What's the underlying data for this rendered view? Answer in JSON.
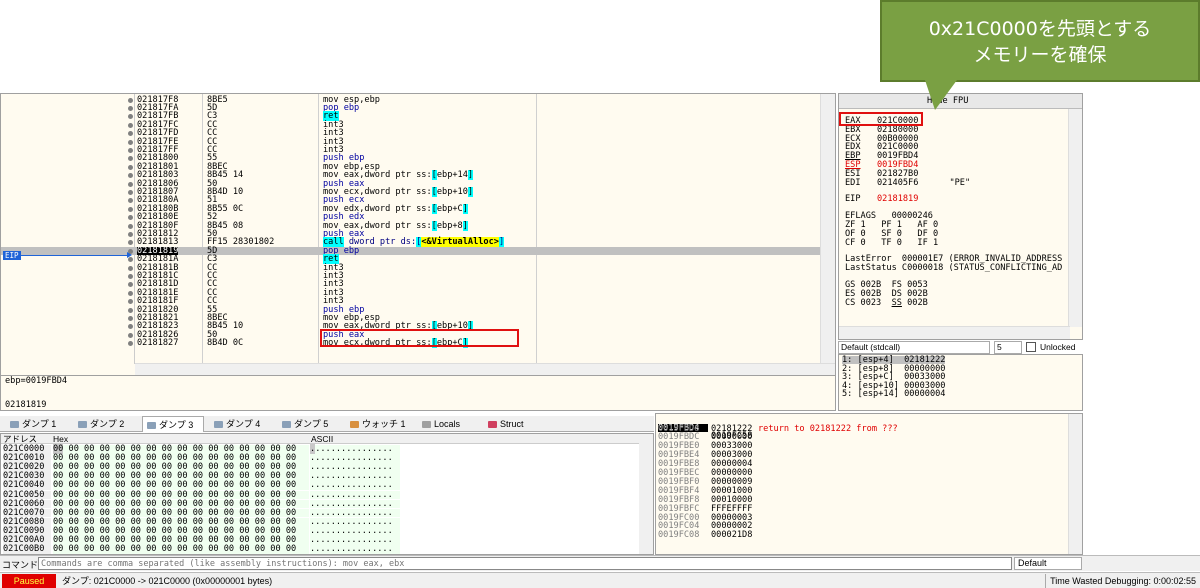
{
  "callout": {
    "line1": "0x21C0000を先頭とする",
    "line2": "メモリーを確保"
  },
  "disasm": {
    "eip_label": "EIP",
    "rows": [
      {
        "addr": "021817F8",
        "bytes": "8BE5",
        "instr": "mov esp,ebp"
      },
      {
        "addr": "021817FA",
        "bytes": "5D",
        "instr": "pop ebp"
      },
      {
        "addr": "021817FB",
        "bytes": "C3",
        "instr": "ret"
      },
      {
        "addr": "021817FC",
        "bytes": "CC",
        "instr": "int3"
      },
      {
        "addr": "021817FD",
        "bytes": "CC",
        "instr": "int3"
      },
      {
        "addr": "021817FE",
        "bytes": "CC",
        "instr": "int3"
      },
      {
        "addr": "021817FF",
        "bytes": "CC",
        "instr": "int3"
      },
      {
        "addr": "02181800",
        "bytes": "55",
        "instr": "push ebp"
      },
      {
        "addr": "02181801",
        "bytes": "8BEC",
        "instr": "mov ebp,esp"
      },
      {
        "addr": "02181803",
        "bytes": "8B45 14",
        "instr": "mov eax,dword ptr ss:[ebp+14]"
      },
      {
        "addr": "02181806",
        "bytes": "50",
        "instr": "push eax"
      },
      {
        "addr": "02181807",
        "bytes": "8B4D 10",
        "instr": "mov ecx,dword ptr ss:[ebp+10]"
      },
      {
        "addr": "0218180A",
        "bytes": "51",
        "instr": "push ecx"
      },
      {
        "addr": "0218180B",
        "bytes": "8B55 0C",
        "instr": "mov edx,dword ptr ss:[ebp+C]"
      },
      {
        "addr": "0218180E",
        "bytes": "52",
        "instr": "push edx"
      },
      {
        "addr": "0218180F",
        "bytes": "8B45 08",
        "instr": "mov eax,dword ptr ss:[ebp+8]"
      },
      {
        "addr": "02181812",
        "bytes": "50",
        "instr": "push eax"
      },
      {
        "addr": "02181813",
        "bytes": "FF15 28301802",
        "instr": "call dword ptr ds:[<&VirtualAlloc>]"
      },
      {
        "addr": "02181819",
        "bytes": "5D",
        "instr": "pop ebp"
      },
      {
        "addr": "0218181A",
        "bytes": "C3",
        "instr": "ret"
      },
      {
        "addr": "0218181B",
        "bytes": "CC",
        "instr": "int3"
      },
      {
        "addr": "0218181C",
        "bytes": "CC",
        "instr": "int3"
      },
      {
        "addr": "0218181D",
        "bytes": "CC",
        "instr": "int3"
      },
      {
        "addr": "0218181E",
        "bytes": "CC",
        "instr": "int3"
      },
      {
        "addr": "0218181F",
        "bytes": "CC",
        "instr": "int3"
      },
      {
        "addr": "02181820",
        "bytes": "55",
        "instr": "push ebp"
      },
      {
        "addr": "02181821",
        "bytes": "8BEC",
        "instr": "mov ebp,esp"
      },
      {
        "addr": "02181823",
        "bytes": "8B45 10",
        "instr": "mov eax,dword ptr ss:[ebp+10]"
      },
      {
        "addr": "02181826",
        "bytes": "50",
        "instr": "push eax"
      },
      {
        "addr": "02181827",
        "bytes": "8B4D 0C",
        "instr": "mov ecx,dword ptr ss:[ebp+C]"
      }
    ]
  },
  "info": {
    "line1": "ebp=0019FBD4",
    "line2": "02181819"
  },
  "registers": {
    "title": "Hide FPU",
    "gp": [
      {
        "name": "EAX",
        "val": "021C0000",
        "red": false
      },
      {
        "name": "EBX",
        "val": "02180000",
        "red": false
      },
      {
        "name": "ECX",
        "val": "00B00000",
        "red": false
      },
      {
        "name": "EDX",
        "val": "021C0000",
        "red": false
      },
      {
        "name": "EBP",
        "val": "0019FBD4",
        "red": false
      },
      {
        "name": "ESP",
        "val": "0019FBD4",
        "red": true
      },
      {
        "name": "ESI",
        "val": "021827B0",
        "red": false
      },
      {
        "name": "EDI",
        "val": "021405F6",
        "red": false,
        "comment": "\"PE\""
      }
    ],
    "eip": {
      "name": "EIP",
      "val": "02181819"
    },
    "eflags": {
      "name": "EFLAGS",
      "val": "00000246"
    },
    "flags_line1": "ZF 1   PF 1   AF 0",
    "flags_line2": "OF 0   SF 0   DF 0",
    "flags_line3": "CF 0   TF 0   IF 1",
    "lasterror": "LastError  000001E7 (ERROR_INVALID_ADDRESS",
    "laststatus": "LastStatus C0000018 (STATUS_CONFLICTING_AD",
    "seg1": "GS 002B  FS 0053",
    "seg2": "ES 002B  DS 002B",
    "seg3": "CS 0023  SS 002B"
  },
  "callconv": {
    "selected": "Default (stdcall)",
    "count": "5",
    "unlocked_label": "Unlocked"
  },
  "args": [
    "1: [esp+4]  02181222",
    "2: [esp+8]  00000000",
    "3: [esp+C]  00033000",
    "4: [esp+10] 00003000",
    "5: [esp+14] 00000004"
  ],
  "tabs": [
    {
      "label": "ダンプ 1",
      "icon": "dump-icon"
    },
    {
      "label": "ダンプ 2",
      "icon": "dump-icon"
    },
    {
      "label": "ダンプ 3",
      "icon": "dump-icon",
      "active": true
    },
    {
      "label": "ダンプ 4",
      "icon": "dump-icon"
    },
    {
      "label": "ダンプ 5",
      "icon": "dump-icon"
    },
    {
      "label": "ウォッチ 1",
      "icon": "watch-icon"
    },
    {
      "label": "Locals",
      "icon": "locals-icon"
    },
    {
      "label": "Struct",
      "icon": "struct-icon"
    }
  ],
  "dump": {
    "headers": {
      "addr": "アドレス",
      "hex": "Hex",
      "ascii": "ASCII"
    },
    "rows": [
      {
        "addr": "021C0000",
        "hex": "00 00 00 00 00 00 00 00 00 00 00 00 00 00 00 00",
        "ascii": "................"
      },
      {
        "addr": "021C0010",
        "hex": "00 00 00 00 00 00 00 00 00 00 00 00 00 00 00 00",
        "ascii": "................"
      },
      {
        "addr": "021C0020",
        "hex": "00 00 00 00 00 00 00 00 00 00 00 00 00 00 00 00",
        "ascii": "................"
      },
      {
        "addr": "021C0030",
        "hex": "00 00 00 00 00 00 00 00 00 00 00 00 00 00 00 00",
        "ascii": "................"
      },
      {
        "addr": "021C0040",
        "hex": "00 00 00 00 00 00 00 00 00 00 00 00 00 00 00 00",
        "ascii": "................"
      },
      {
        "addr": "021C0050",
        "hex": "00 00 00 00 00 00 00 00 00 00 00 00 00 00 00 00",
        "ascii": "................"
      },
      {
        "addr": "021C0060",
        "hex": "00 00 00 00 00 00 00 00 00 00 00 00 00 00 00 00",
        "ascii": "................"
      },
      {
        "addr": "021C0070",
        "hex": "00 00 00 00 00 00 00 00 00 00 00 00 00 00 00 00",
        "ascii": "................"
      },
      {
        "addr": "021C0080",
        "hex": "00 00 00 00 00 00 00 00 00 00 00 00 00 00 00 00",
        "ascii": "................"
      },
      {
        "addr": "021C0090",
        "hex": "00 00 00 00 00 00 00 00 00 00 00 00 00 00 00 00",
        "ascii": "................"
      },
      {
        "addr": "021C00A0",
        "hex": "00 00 00 00 00 00 00 00 00 00 00 00 00 00 00 00",
        "ascii": "................"
      },
      {
        "addr": "021C00B0",
        "hex": "00 00 00 00 00 00 00 00 00 00 00 00 00 00 00 00",
        "ascii": "................"
      }
    ]
  },
  "stack": {
    "header_addr": "0019FBD4",
    "header_val": "0019FC58",
    "rows": [
      {
        "addr": "0019FBD8",
        "val": "02181222",
        "comment": "return to 02181222 from ???"
      },
      {
        "addr": "0019FBDC",
        "val": "00000000",
        "comment": ""
      },
      {
        "addr": "0019FBE0",
        "val": "00033000",
        "comment": ""
      },
      {
        "addr": "0019FBE4",
        "val": "00003000",
        "comment": ""
      },
      {
        "addr": "0019FBE8",
        "val": "00000004",
        "comment": ""
      },
      {
        "addr": "0019FBEC",
        "val": "00000000",
        "comment": ""
      },
      {
        "addr": "0019FBF0",
        "val": "00000009",
        "comment": ""
      },
      {
        "addr": "0019FBF4",
        "val": "00001000",
        "comment": ""
      },
      {
        "addr": "0019FBF8",
        "val": "00010000",
        "comment": ""
      },
      {
        "addr": "0019FBFC",
        "val": "FFFEFFFF",
        "comment": ""
      },
      {
        "addr": "0019FC00",
        "val": "00000003",
        "comment": ""
      },
      {
        "addr": "0019FC04",
        "val": "00000002",
        "comment": ""
      },
      {
        "addr": "0019FC08",
        "val": "000021D8",
        "comment": ""
      }
    ]
  },
  "command": {
    "label": "コマンド:",
    "placeholder": "Commands are comma separated (like assembly instructions): mov eax, ebx",
    "mode": "Default"
  },
  "status": {
    "paused": "Paused",
    "message": "ダンプ: 021C0000 -> 021C0000 (0x00000001 bytes)",
    "time": "Time Wasted Debugging: 0:00:02:55"
  }
}
